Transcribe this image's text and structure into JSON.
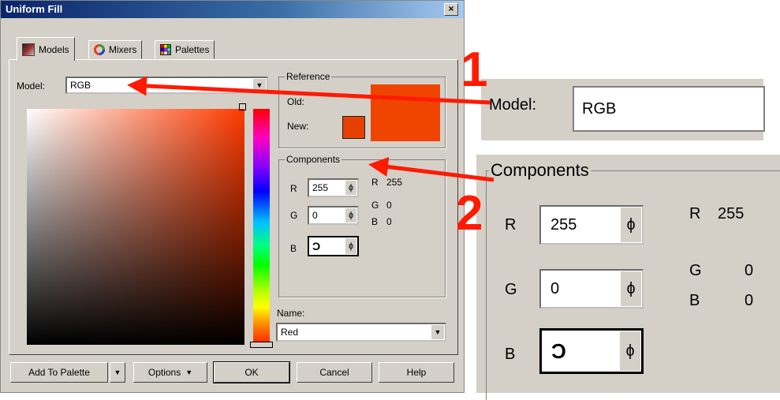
{
  "dialog": {
    "title": "Uniform Fill",
    "close_glyph": "×",
    "tabs": [
      {
        "label": "Models",
        "icon": "models-icon"
      },
      {
        "label": "Mixers",
        "icon": "mixers-icon"
      },
      {
        "label": "Palettes",
        "icon": "palettes-icon"
      }
    ],
    "model": {
      "label": "Model:",
      "value": "RGB"
    },
    "reference": {
      "title": "Reference",
      "old_label": "Old:",
      "new_label": "New:"
    },
    "components": {
      "title": "Components",
      "r_label": "R",
      "r_value": "255",
      "g_label": "G",
      "g_value": "0",
      "b_label": "B",
      "b_value": "",
      "readout_r_label": "R",
      "readout_r_value": "255",
      "readout_g_label": "G",
      "readout_g_value": "0",
      "readout_b_label": "B",
      "readout_b_value": "0"
    },
    "name": {
      "label": "Name:",
      "value": "Red"
    },
    "buttons": {
      "add_to_palette": "Add To Palette",
      "options": "Options",
      "ok": "OK",
      "cancel": "Cancel",
      "help": "Help"
    },
    "colors": {
      "old_swatch": "#ee4400",
      "new_swatch": "#e64000",
      "title_bar": "#0a246a"
    }
  },
  "zoom": {
    "callout1_number": "1",
    "callout2_number": "2",
    "model_label": "Model:",
    "model_value": "RGB",
    "components_title": "Components",
    "r_label": "R",
    "r_value": "255",
    "g_label": "G",
    "g_value": "0",
    "b_label": "B",
    "b_value": "",
    "readout_r_label": "R",
    "readout_r_value": "255",
    "readout_g_label": "G",
    "readout_g_value": "0",
    "readout_b_label": "B",
    "readout_b_value": "0"
  },
  "annotation_color": "#ff1a00"
}
